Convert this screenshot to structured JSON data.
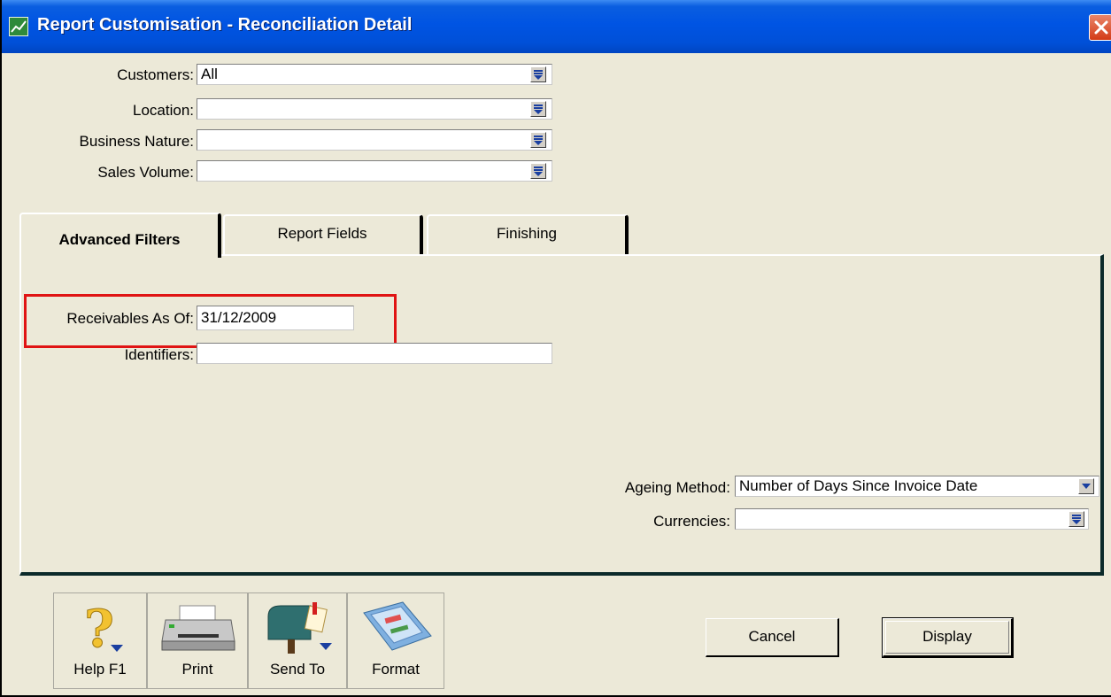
{
  "window": {
    "title": "Report Customisation - Reconciliation Detail"
  },
  "filters": {
    "customers": {
      "label": "Customers:",
      "value": "All"
    },
    "location": {
      "label": "Location:",
      "value": ""
    },
    "business_nature": {
      "label": "Business Nature:",
      "value": ""
    },
    "sales_volume": {
      "label": "Sales Volume:",
      "value": ""
    }
  },
  "tabs": [
    {
      "label": "Advanced Filters",
      "mnemonic": "d",
      "active": true
    },
    {
      "label": "Report Fields",
      "mnemonic": "R",
      "active": false
    },
    {
      "label": "Finishing",
      "mnemonic": "F",
      "active": false
    }
  ],
  "advanced": {
    "receivables_as_of": {
      "label": "Receivables As Of:",
      "value": "31/12/2009"
    },
    "identifiers": {
      "label": "Identifiers:",
      "value": ""
    },
    "ageing_method": {
      "label": "Ageing Method:",
      "value": "Number of Days Since Invoice Date"
    },
    "currencies": {
      "label": "Currencies:",
      "value": ""
    }
  },
  "toolbar": [
    {
      "label": "Help F1",
      "icon": "help-icon"
    },
    {
      "label": "Print",
      "icon": "printer-icon"
    },
    {
      "label": "Send To",
      "icon": "mailbox-icon"
    },
    {
      "label": "Format",
      "icon": "format-icon"
    }
  ],
  "actions": {
    "cancel_label": "Cancel",
    "display_label": "Display"
  },
  "colors": {
    "title_bar": "#0054e3",
    "window_bg": "#ece9d8",
    "highlight": "#e01414"
  }
}
